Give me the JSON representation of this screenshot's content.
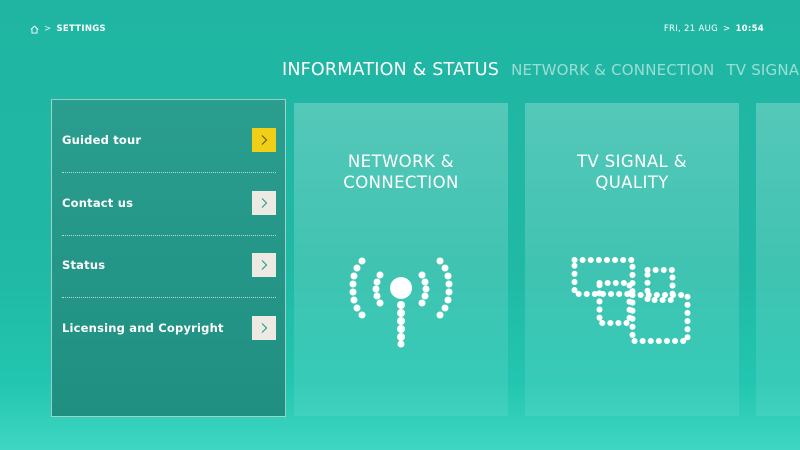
{
  "header": {
    "breadcrumb": "SETTINGS",
    "breadcrumb_separator": ">",
    "date": "FRI, 21 AUG",
    "time_separator": ">",
    "time": "10:54"
  },
  "tabs": [
    {
      "label": "INFORMATION & STATUS",
      "active": true
    },
    {
      "label": "NETWORK & CONNECTION",
      "active": false
    },
    {
      "label": "TV SIGNA",
      "active": false
    }
  ],
  "menu": {
    "items": [
      {
        "label": "Guided tour",
        "focused": true
      },
      {
        "label": "Contact us",
        "focused": false
      },
      {
        "label": "Status",
        "focused": false
      },
      {
        "label": "Licensing and Copyright",
        "focused": false
      }
    ]
  },
  "cards": [
    {
      "title_line1": "NETWORK &",
      "title_line2": "CONNECTION",
      "icon": "wifi-signal-icon"
    },
    {
      "title_line1": "TV SIGNAL &",
      "title_line2": "QUALITY",
      "icon": "tv-signal-quality-icon"
    }
  ],
  "colors": {
    "background": "#20b9a5",
    "panel": "#1f8f81",
    "focus": "#f2cf17",
    "arrow_button": "#eceae2"
  }
}
